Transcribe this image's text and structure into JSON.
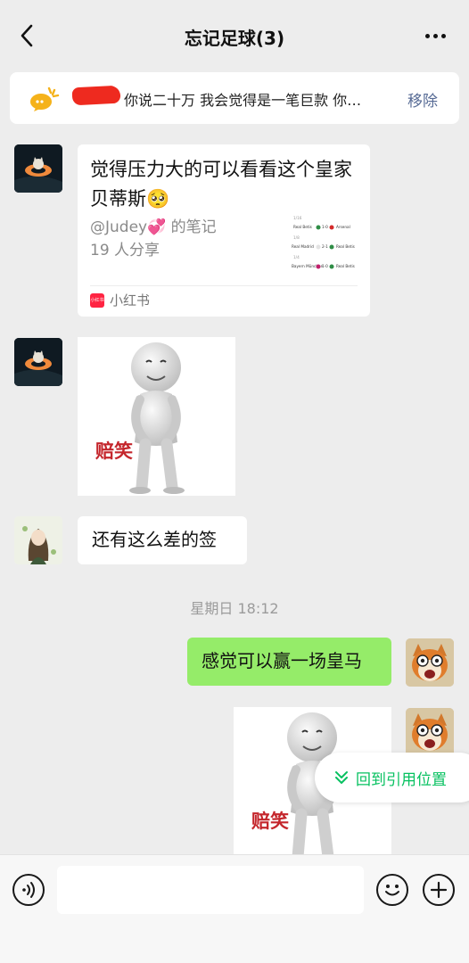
{
  "header": {
    "title": "忘记足球(3)",
    "back_icon": "chevron-left-icon",
    "more_icon": "ellipsis-icon"
  },
  "pinned": {
    "icon": "bulb-chat-icon",
    "text": "你说二十万 我会觉得是一笔巨款 你…",
    "remove_label": "移除"
  },
  "messages": {
    "share_card": {
      "title": "觉得压力大的可以看看这个皇家贝蒂斯🥺",
      "author": "@Judey💞 的笔记",
      "shares": "19 人分享",
      "source": "小红书",
      "source_logo_text": "小红书",
      "thumb_rows": [
        {
          "home": "Real Betis",
          "score": "1-0",
          "away": "Arsenal"
        },
        {
          "home": "Real Madrid",
          "score": "2-1",
          "away": "Real Betis"
        },
        {
          "home": "Bayern München",
          "score": "1-0",
          "away": "Real Betis"
        }
      ]
    },
    "sticker_1": {
      "caption": "赔笑"
    },
    "text_1": "还有这么差的签",
    "timestamp": "星期日 18:12",
    "my_text": "感觉可以赢一场皇马",
    "sticker_2": {
      "caption": "赔笑"
    }
  },
  "jump_button": {
    "label": "回到引用位置",
    "icon": "double-chevron-down-icon"
  },
  "input": {
    "voice_icon": "voice-icon",
    "value": "",
    "emoji_icon": "emoji-icon",
    "plus_icon": "plus-icon"
  },
  "colors": {
    "background": "#ededed",
    "my_bubble": "#95ec69",
    "link_blue": "#576b95",
    "accent_green": "#07c160",
    "xhs_red": "#ff2442"
  }
}
